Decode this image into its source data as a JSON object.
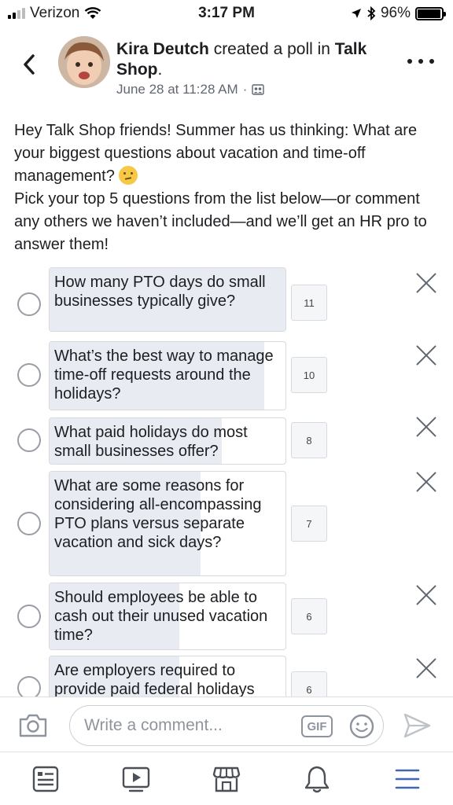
{
  "status_bar": {
    "carrier": "Verizon",
    "time": "3:17 PM",
    "battery": "96%",
    "icons": [
      "signal-icon",
      "wifi-icon",
      "location-arrow-icon",
      "bluetooth-icon",
      "battery-icon"
    ]
  },
  "post": {
    "author": "Kira Deutch",
    "action": " created a poll in ",
    "group": "Talk Shop",
    "group_suffix": ".",
    "timestamp": "June 28 at 11:28 AM",
    "separator": "·",
    "privacy_icon": "group-privacy-icon",
    "body_line1": "Hey Talk Shop friends! Summer has us thinking: What are your biggest questions about vacation and time-off management?",
    "emoji": "thinking-face-emoji",
    "body_line2": "Pick your top 5 questions from the list below—or comment any others we haven’t included—and we’ll get an HR pro to answer them!"
  },
  "poll": {
    "options": [
      {
        "text": "How many PTO days do small businesses typically give?",
        "votes": "11",
        "fill": 1.0
      },
      {
        "text": "What’s the best way to manage time-off requests around the holidays?",
        "votes": "10",
        "fill": 0.91
      },
      {
        "text": "What paid holidays do most small businesses offer?",
        "votes": "8",
        "fill": 0.73
      },
      {
        "text": "What are some reasons for considering all-encompassing PTO plans versus separate vacation and sick days?",
        "votes": "7",
        "fill": 0.64
      },
      {
        "text": "Should employees be able to cash out their unused vacation time?",
        "votes": "6",
        "fill": 0.55
      },
      {
        "text": "Are employers required to provide paid federal holidays",
        "votes": "6",
        "fill": 0.55
      }
    ]
  },
  "comment_bar": {
    "placeholder": "Write a comment...",
    "gif_label": "GIF"
  },
  "tab_bar": {
    "tabs": [
      "news-feed-icon",
      "watch-icon",
      "marketplace-icon",
      "notifications-icon",
      "menu-icon"
    ]
  },
  "colors": {
    "poll_fill": "#e9ebf3",
    "text": "#1c1e21",
    "secondary_text": "#606770"
  }
}
